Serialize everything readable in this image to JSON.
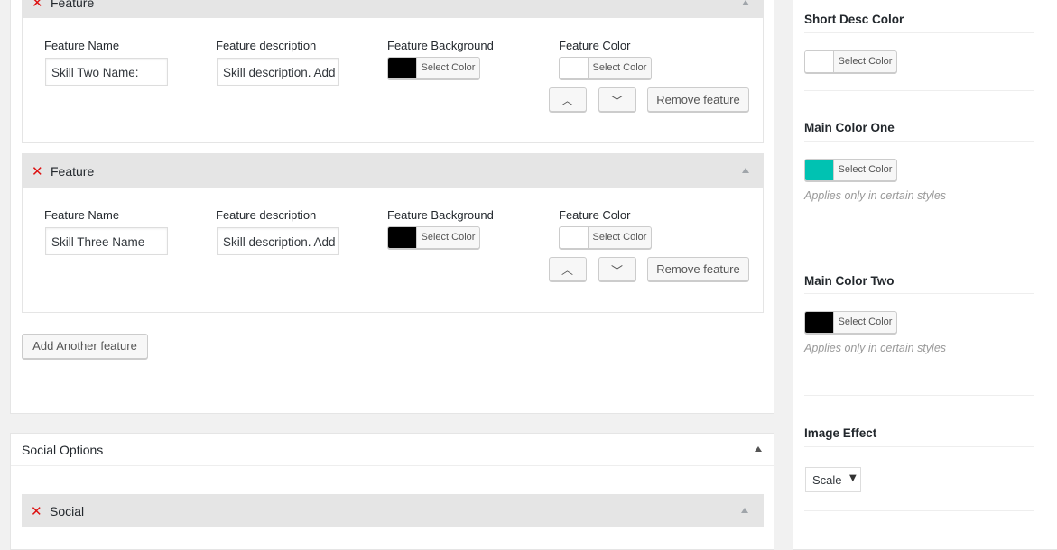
{
  "features": [
    {
      "title": "Feature",
      "name_label": "Feature Name",
      "desc_label": "Feature description",
      "bg_label": "Feature Background",
      "color_label": "Feature Color",
      "name_value": "Skill Two Name:",
      "desc_value": "Skill description. Add",
      "bg_color": "#000000",
      "text_color": "#ffffff",
      "select_color": "Select Color",
      "remove": "Remove feature"
    },
    {
      "title": "Feature",
      "name_label": "Feature Name",
      "desc_label": "Feature description",
      "bg_label": "Feature Background",
      "color_label": "Feature Color",
      "name_value": "Skill Three Name",
      "desc_value": "Skill description. Add",
      "bg_color": "#000000",
      "text_color": "#ffffff",
      "select_color": "Select Color",
      "remove": "Remove feature"
    }
  ],
  "add_feature": "Add Another feature",
  "social": {
    "section_title": "Social Options",
    "item_title": "Social"
  },
  "sidebar": {
    "short_desc": {
      "title": "Short Desc Color",
      "color": "#ffffff",
      "button": "Select Color"
    },
    "main_one": {
      "title": "Main Color One",
      "color": "#00c2b2",
      "button": "Select Color",
      "hint": "Applies only in certain styles"
    },
    "main_two": {
      "title": "Main Color Two",
      "color": "#000000",
      "button": "Select Color",
      "hint": "Applies only in certain styles"
    },
    "image_effect": {
      "title": "Image Effect",
      "value": "Scale"
    }
  },
  "icons": {
    "remove": "close-icon",
    "collapse": "triangle-up-icon",
    "move_up": "chevron-up-icon",
    "move_down": "chevron-down-icon",
    "dropdown": "caret-down-icon"
  }
}
